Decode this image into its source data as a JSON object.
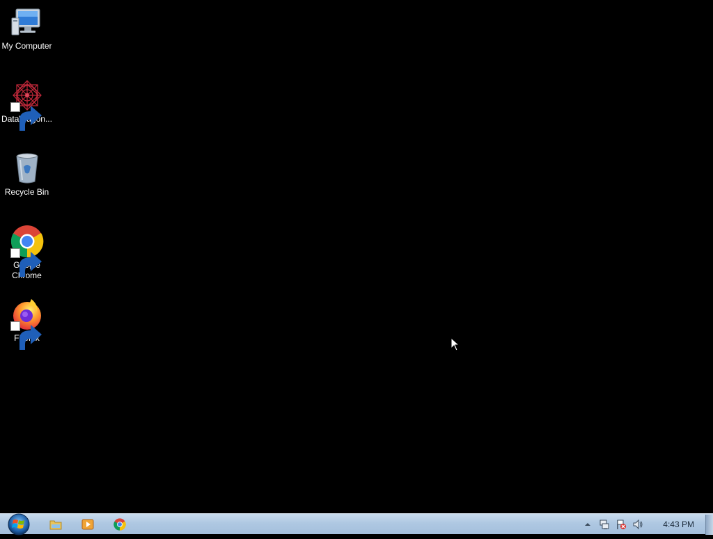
{
  "desktop": {
    "background_color": "#000000",
    "icons": [
      {
        "label": "My Computer",
        "icon": "computer-icon",
        "shortcut": false
      },
      {
        "label": "DataWagon...",
        "icon": "datawagon-icon",
        "shortcut": true
      },
      {
        "label": "Recycle Bin",
        "icon": "recycle-bin-icon",
        "shortcut": false
      },
      {
        "label": "Google Chrome",
        "icon": "chrome-icon",
        "shortcut": true
      },
      {
        "label": "Firefox",
        "icon": "firefox-icon",
        "shortcut": true
      }
    ]
  },
  "taskbar": {
    "start_icon": "windows-start-icon",
    "pinned": [
      {
        "name": "Windows Explorer",
        "icon": "folder-icon"
      },
      {
        "name": "Windows Media Player",
        "icon": "media-player-icon"
      },
      {
        "name": "Google Chrome",
        "icon": "chrome-icon"
      }
    ],
    "tray": {
      "icons": [
        "show-hidden-icons-arrow",
        "network-icon",
        "action-center-flag-icon",
        "volume-icon"
      ],
      "clock": "4:43 PM"
    },
    "colors": {
      "bar": "#afc8e2",
      "clock_text": "#1d2c3c"
    }
  }
}
